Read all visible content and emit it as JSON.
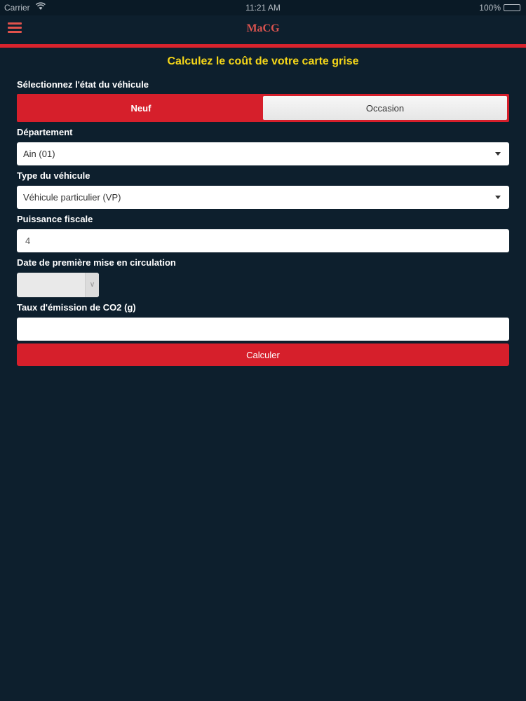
{
  "status_bar": {
    "carrier": "Carrier",
    "time": "11:21 AM",
    "battery": "100%"
  },
  "nav": {
    "title": "MaCG",
    "menu_icon": "hamburger-menu-icon"
  },
  "form": {
    "heading": "Calculez le coût de votre carte grise",
    "vehicle_state": {
      "label": "Sélectionnez l'état du véhicule",
      "options": [
        "Neuf",
        "Occasion"
      ],
      "selected": "Neuf"
    },
    "department": {
      "label": "Département",
      "value": "Ain (01)"
    },
    "vehicle_type": {
      "label": "Type du véhicule",
      "value": "Véhicule particulier (VP)"
    },
    "fiscal_power": {
      "label": "Puissance fiscale",
      "value": "4"
    },
    "first_registration": {
      "label": "Date de première mise en circulation",
      "value": ""
    },
    "co2": {
      "label": "Taux d'émission de CO2 (g)",
      "value": ""
    },
    "submit_label": "Calculer"
  },
  "colors": {
    "background": "#0d1f2d",
    "accent": "#d61f2b",
    "heading": "#f5d619"
  }
}
